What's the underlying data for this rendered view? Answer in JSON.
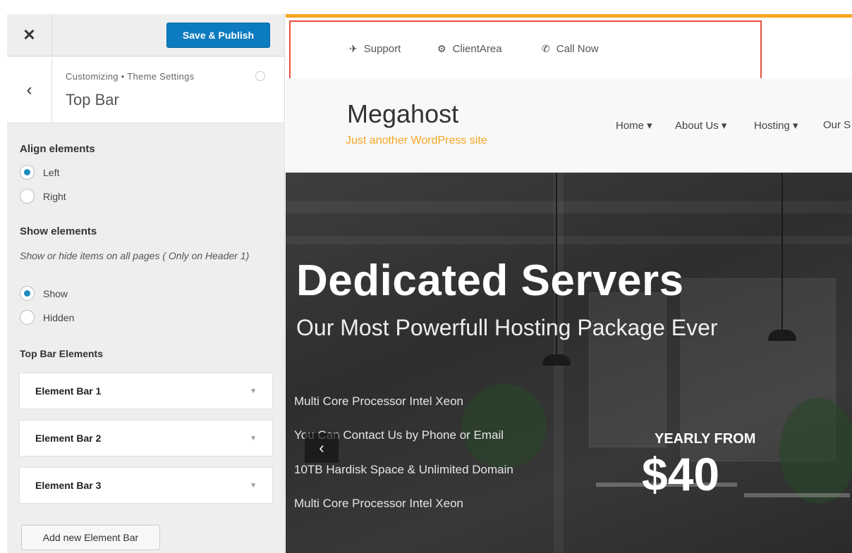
{
  "customizer": {
    "close_icon": "close-icon",
    "publish_label": "Save & Publish",
    "back_icon": "chevron-left-icon",
    "breadcrumb": "Customizing • Theme Settings",
    "section_title": "Top Bar",
    "align": {
      "label": "Align elements",
      "options": [
        "Left",
        "Right"
      ],
      "selected": "Left"
    },
    "show": {
      "label": "Show elements",
      "description": "Show or hide items on all pages ( Only on Header 1)",
      "options": [
        "Show",
        "Hidden"
      ],
      "selected": "Show"
    },
    "elements": {
      "label": "Top Bar Elements",
      "items": [
        "Element Bar 1",
        "Element Bar 2",
        "Element Bar 3"
      ]
    },
    "add_label": "Add new Element Bar"
  },
  "preview": {
    "accent_color": "#f5a623",
    "highlight_color": "#e74c3c",
    "topbar": [
      {
        "icon": "plane-icon",
        "label": "Support"
      },
      {
        "icon": "gears-icon",
        "label": "ClientArea"
      },
      {
        "icon": "phone-icon",
        "label": "Call Now"
      }
    ],
    "site_title": "Megahost",
    "tagline": "Just another WordPress site",
    "nav": [
      "Home ▾",
      "About Us ▾",
      "Hosting ▾",
      "Our S"
    ],
    "hero": {
      "title": "Dedicated Servers",
      "subtitle": "Our Most Powerfull Hosting Package Ever",
      "features": [
        "Multi Core Processor Intel Xeon",
        "You Can Contact Us by Phone or Email",
        "10TB Hardisk Space & Unlimited Domain",
        "Multi Core Processor Intel Xeon"
      ],
      "price_caption": "YEARLY FROM",
      "price": "$40",
      "prev_icon": "chevron-left-icon"
    }
  }
}
